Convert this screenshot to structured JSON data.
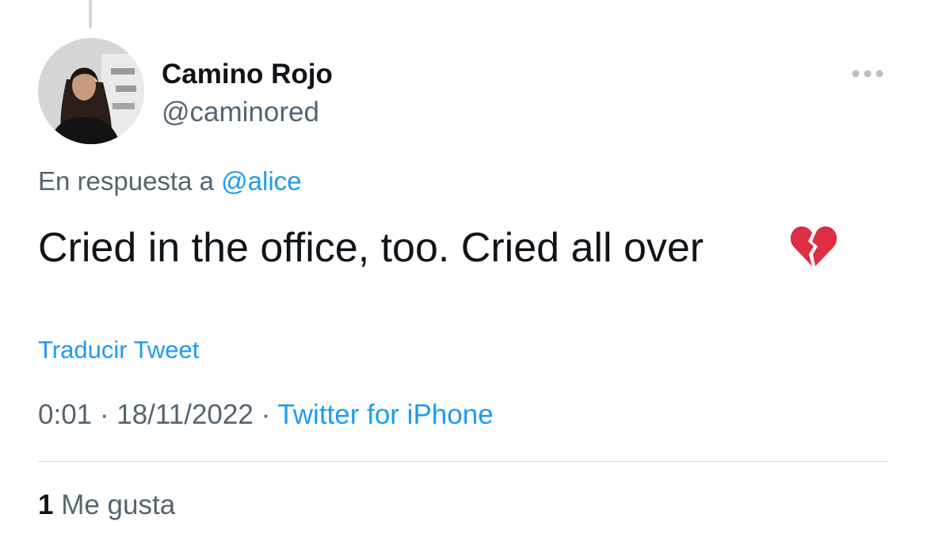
{
  "author": {
    "display_name": "Camino Rojo",
    "handle": "@caminored"
  },
  "reply": {
    "prefix": "En respuesta a",
    "to_handle": "@alice"
  },
  "tweet": {
    "text": "Cried in the office, too. Cried all over",
    "emoji_icon": "broken-heart-icon",
    "translate_label": "Traducir Tweet"
  },
  "meta": {
    "time": "0:01",
    "separator": "·",
    "date": "18/11/2022",
    "source": "Twitter for iPhone"
  },
  "engagement": {
    "likes_count": "1",
    "likes_label": "Me gusta"
  },
  "colors": {
    "link": "#1d9bf0",
    "text_primary": "#0f1419",
    "text_secondary": "#536471",
    "divider": "#cfd9de",
    "emoji": "#dd2e44"
  }
}
